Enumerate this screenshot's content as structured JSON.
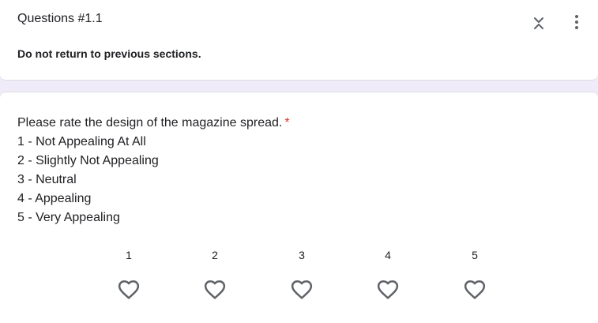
{
  "section": {
    "title": "Questions #1.1",
    "description": "Do not return to previous sections."
  },
  "question": {
    "prompt": "Please rate the design of the magazine spread.",
    "required_mark": "*",
    "scale_lines": [
      "1 - Not Appealing At All",
      "2 - Slightly Not Appealing",
      "3 - Neutral",
      "4 - Appealing",
      "5 - Very Appealing"
    ]
  },
  "rating": {
    "options": [
      "1",
      "2",
      "3",
      "4",
      "5"
    ],
    "icon": "heart-outline-icon",
    "selected": null
  },
  "icons": {
    "collapse": "collapse-expand-icon",
    "more": "more-vert-icon"
  },
  "colors": {
    "background": "#f0ebf8",
    "required": "#d93025",
    "icon": "#5f6368",
    "text": "#202124"
  }
}
